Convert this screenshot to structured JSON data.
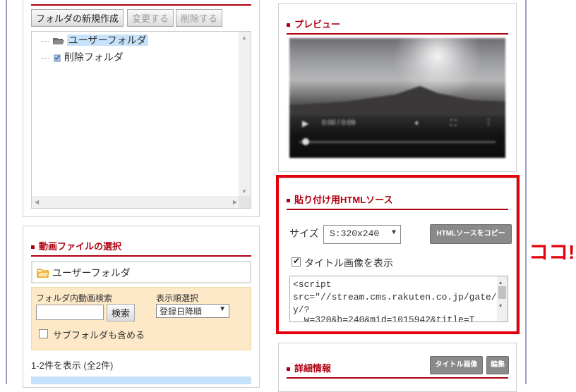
{
  "folder_toolbar": {
    "new_folder": "フォルダの新規作成",
    "rename": "変更する",
    "delete": "削除する"
  },
  "folder_tree": {
    "items": [
      {
        "label": "ユーザーフォルダ",
        "icon": "folder-open-icon",
        "selected": true
      },
      {
        "label": "削除フォルダ",
        "icon": "trash-folder-icon",
        "selected": false
      }
    ]
  },
  "preview": {
    "title": "プレビュー",
    "controls": {
      "time": "0:00 / 0:09"
    }
  },
  "embed": {
    "title": "貼り付け用HTMLソース",
    "size_label": "サイズ",
    "size_value": "S:320x240",
    "copy_button": "HTMLソースをコピー",
    "show_title_label": "タイトル画像を表示",
    "show_title_checked": true,
    "source_lines": [
      "<script",
      "src=\"//stream.cms.rakuten.co.jp/gate/pla",
      "y/?",
      "  w=320&h=240&mid=1015942&title=T"
    ]
  },
  "video_select": {
    "title": "動画ファイルの選択",
    "folder_name": "ユーザーフォルダ",
    "search_label": "フォルダ内動画検索",
    "search_value": "",
    "search_button": "検索",
    "sort_label": "表示順選択",
    "sort_value": "登録日降順",
    "include_subfolders": "サブフォルダも含める",
    "result_count": "1-2件を表示 (全2件)"
  },
  "details": {
    "title": "詳細情報",
    "title_image_button": "タイトル画像",
    "edit_button": "編集"
  },
  "annotation": {
    "text": "ココ!"
  },
  "colors": {
    "accent": "#b00010",
    "highlight": "#e3000b",
    "folder": "#e8a317"
  }
}
